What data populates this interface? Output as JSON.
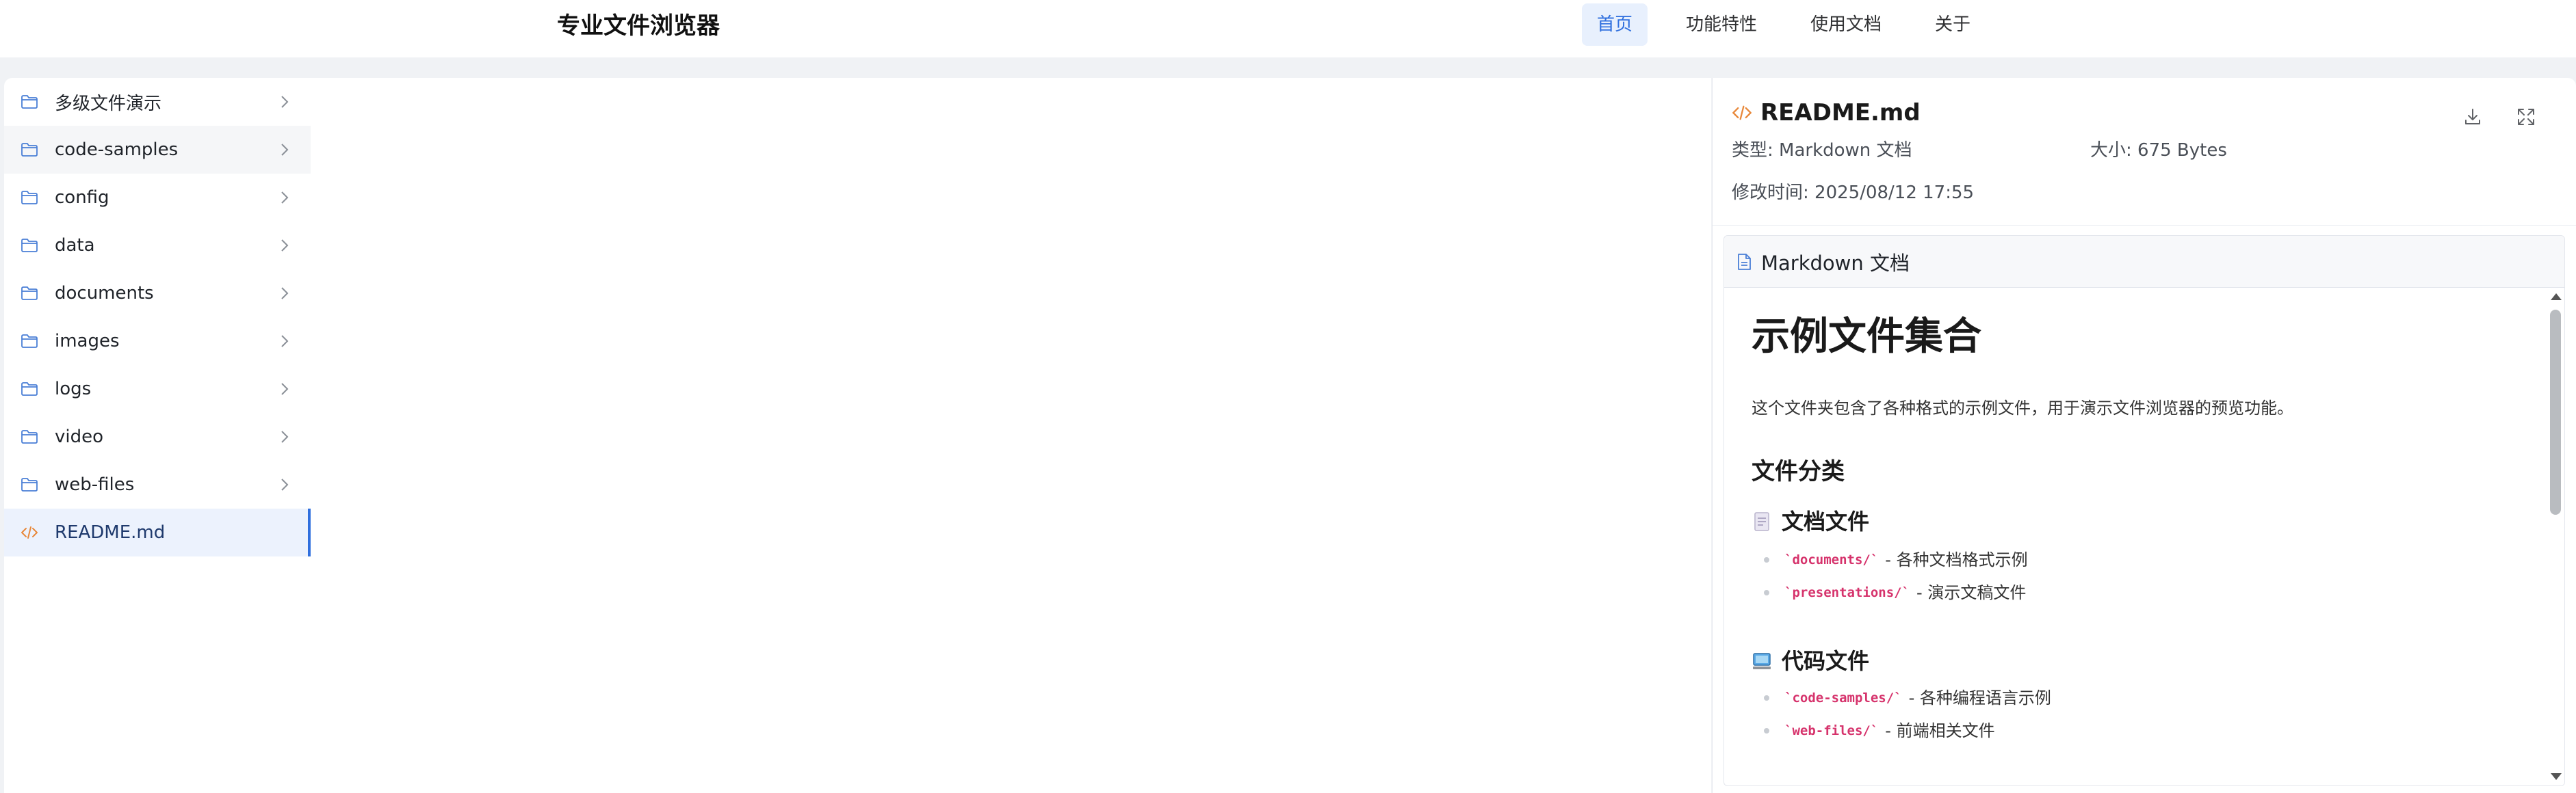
{
  "header": {
    "title": "专业文件浏览器",
    "nav": [
      {
        "label": "首页",
        "active": true
      },
      {
        "label": "功能特性",
        "active": false
      },
      {
        "label": "使用文档",
        "active": false
      },
      {
        "label": "关于",
        "active": false
      }
    ]
  },
  "tree": {
    "items": [
      {
        "label": "多级文件演示",
        "type": "folder"
      },
      {
        "label": "code-samples",
        "type": "folder"
      },
      {
        "label": "config",
        "type": "folder"
      },
      {
        "label": "data",
        "type": "folder"
      },
      {
        "label": "documents",
        "type": "folder"
      },
      {
        "label": "images",
        "type": "folder"
      },
      {
        "label": "logs",
        "type": "folder"
      },
      {
        "label": "video",
        "type": "folder"
      },
      {
        "label": "web-files",
        "type": "folder"
      },
      {
        "label": "README.md",
        "type": "file-code"
      }
    ]
  },
  "preview": {
    "filename": "README.md",
    "type_label": "类型: Markdown 文档",
    "size_label": "大小: 675 Bytes",
    "mtime_label": "修改时间: 2025/08/12 17:55",
    "card_title": "Markdown 文档",
    "content": {
      "h1": "示例文件集合",
      "intro": "这个文件夹包含了各种格式的示例文件，用于演示文件浏览器的预览功能。",
      "h2": "文件分类",
      "sections": [
        {
          "title": "文档文件",
          "icon": "document-emoji-icon",
          "items": [
            {
              "code": "`documents/`",
              "text": "- 各种文档格式示例"
            },
            {
              "code": "`presentations/`",
              "text": "- 演示文稿文件"
            }
          ]
        },
        {
          "title": "代码文件",
          "icon": "computer-emoji-icon",
          "items": [
            {
              "code": "`code-samples/`",
              "text": "- 各种编程语言示例"
            },
            {
              "code": "`web-files/`",
              "text": "- 前端相关文件"
            }
          ]
        }
      ]
    }
  },
  "colors": {
    "accent": "#2f6fde",
    "folder_icon": "#4a7fd6",
    "code_icon": "#e8883a",
    "code_text": "#d6336c"
  }
}
